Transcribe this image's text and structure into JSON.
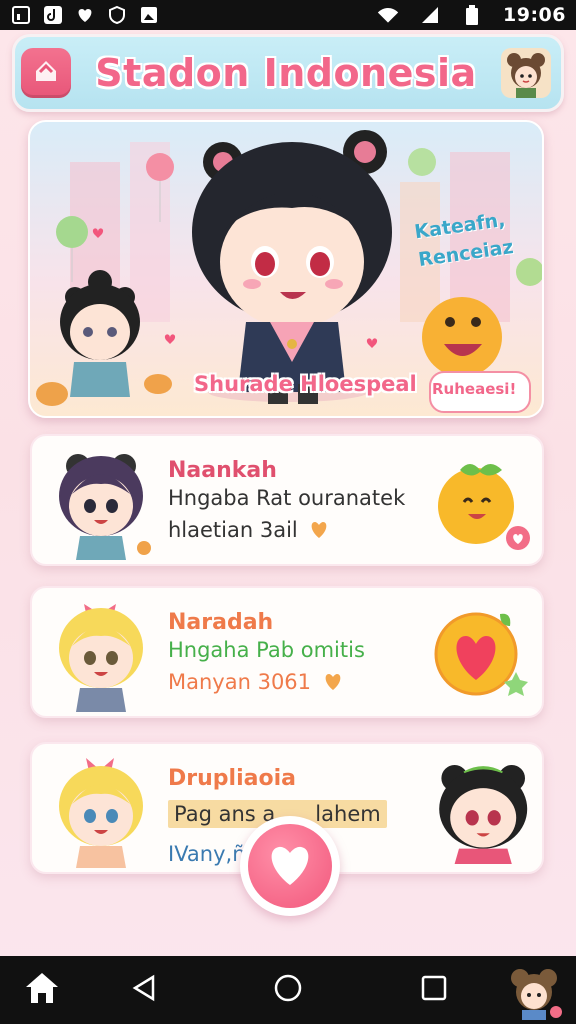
{
  "status_bar": {
    "time": "19:06",
    "left_icons": [
      "notification-icon",
      "tiktok-icon",
      "heart-app-icon",
      "shield-icon",
      "photo-icon"
    ],
    "right_icons": [
      "wifi-icon",
      "signal-icon",
      "battery-icon"
    ]
  },
  "header": {
    "title": "Stadon Indonesia",
    "home_icon": "home-icon",
    "avatar": "profile-avatar"
  },
  "banner": {
    "text_right": "Kateafn, Renceiaz",
    "text_bottom": "Shurade Hloespeal",
    "text_badge": "Ruheaesi!"
  },
  "cards": [
    {
      "title": "Naankah",
      "line1": "Hngaba Rat ouranatek",
      "line2": "hlaetian 3ail",
      "title_color": "#e0506e",
      "line1_color": "#333333",
      "right_icon": "orange-fruit-icon"
    },
    {
      "title": "Naradah",
      "line1": "Hngaha Pab omitis",
      "line2": "Manyan 3061",
      "title_color": "#ef7a4a",
      "line1_color": "#46b04a",
      "right_icon": "heart-fruit-icon"
    },
    {
      "title": "Drupliaoia",
      "line1": "Pag ans a      lahem",
      "line2": "IVany,ñe",
      "title_color": "#ef7a4a",
      "line1_color": "#333333",
      "right_icon": "girl-avatar"
    }
  ],
  "fab": {
    "icon": "heart-icon"
  },
  "nav": {
    "icons": [
      "home-icon",
      "back-icon",
      "circle-home-icon",
      "recents-icon",
      "avatar"
    ]
  },
  "colors": {
    "accent": "#f2678a",
    "header_bg": "#c3ebf5",
    "page_bg": "#fde6ea"
  }
}
